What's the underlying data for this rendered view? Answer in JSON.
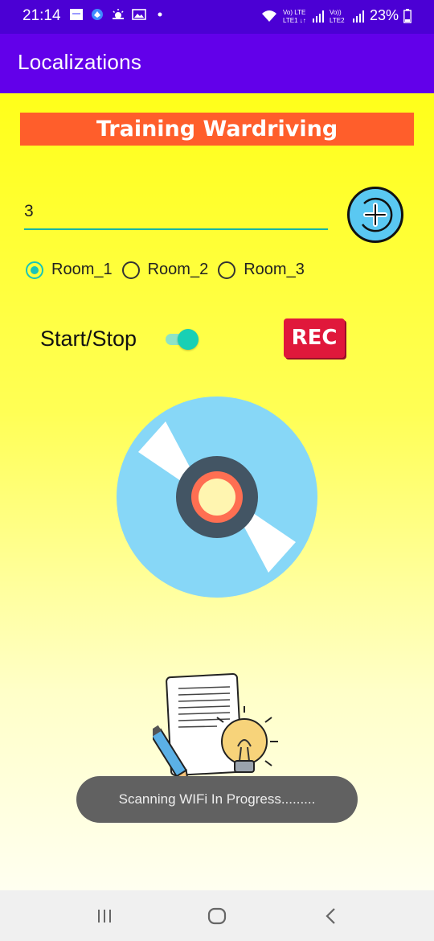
{
  "status_bar": {
    "time": "21:14",
    "battery": "23%",
    "icons": [
      "gallery-icon",
      "app-icon",
      "weather-icon",
      "image-icon",
      "dot-icon",
      "wifi-icon",
      "lte1-icon",
      "signal1-icon",
      "lte2-icon",
      "signal2-icon",
      "battery-icon"
    ]
  },
  "app_bar": {
    "title": "Localizations",
    "color": "#6200EA"
  },
  "banner": {
    "text": "Training Wardriving",
    "color": "#FF5E2B"
  },
  "input": {
    "value": "3"
  },
  "add_button": {
    "icon": "plus-circle-icon"
  },
  "radios": [
    {
      "label": "Room_1",
      "checked": true
    },
    {
      "label": "Room_2",
      "checked": false
    },
    {
      "label": "Room_3",
      "checked": false
    }
  ],
  "toggle": {
    "label": "Start/Stop",
    "on": true
  },
  "rec_button": {
    "label": "REC",
    "color": "#E0183B"
  },
  "toast": {
    "text": "Scanning WIFi In Progress........."
  },
  "nav": {
    "icons": [
      "recent-apps-icon",
      "home-icon",
      "back-icon"
    ]
  }
}
